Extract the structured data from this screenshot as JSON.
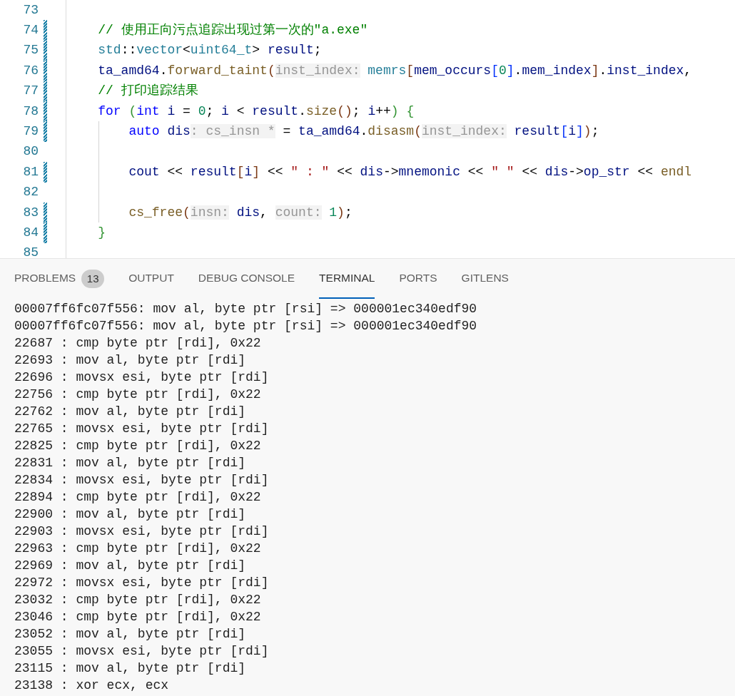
{
  "editor": {
    "lines": [
      {
        "number": "73",
        "modified": false,
        "indent_guide": false
      },
      {
        "number": "74",
        "modified": true,
        "indent_guide": false,
        "tokens": [
          {
            "kind": "comment",
            "text": "    // 使用正向污点追踪出现过第一次的\"a.exe\""
          }
        ]
      },
      {
        "number": "75",
        "modified": true,
        "indent_guide": false,
        "tokens": [
          {
            "kind": "type",
            "text": "    std"
          },
          {
            "kind": "plain",
            "text": "::"
          },
          {
            "kind": "type",
            "text": "vector"
          },
          {
            "kind": "plain",
            "text": "<"
          },
          {
            "kind": "type",
            "text": "uint64_t"
          },
          {
            "kind": "plain",
            "text": "> "
          },
          {
            "kind": "variable",
            "text": "result"
          },
          {
            "kind": "plain",
            "text": ";"
          }
        ]
      },
      {
        "number": "76",
        "modified": true,
        "indent_guide": false,
        "tokens": [
          {
            "kind": "variable",
            "text": "    ta_amd64"
          },
          {
            "kind": "plain",
            "text": "."
          },
          {
            "kind": "function",
            "text": "forward_taint"
          },
          {
            "kind": "bracket3",
            "text": "("
          },
          {
            "kind": "hint",
            "text": "inst_index:"
          },
          {
            "kind": "type",
            "text": " memrs"
          },
          {
            "kind": "bracket3",
            "text": "["
          },
          {
            "kind": "variable",
            "text": "mem_occurs"
          },
          {
            "kind": "bracket1",
            "text": "["
          },
          {
            "kind": "number",
            "text": "0"
          },
          {
            "kind": "bracket1",
            "text": "]"
          },
          {
            "kind": "plain",
            "text": "."
          },
          {
            "kind": "variable",
            "text": "mem_index"
          },
          {
            "kind": "bracket3",
            "text": "]"
          },
          {
            "kind": "plain",
            "text": "."
          },
          {
            "kind": "variable",
            "text": "inst_index"
          },
          {
            "kind": "plain",
            "text": ","
          }
        ]
      },
      {
        "number": "77",
        "modified": true,
        "indent_guide": false,
        "tokens": [
          {
            "kind": "comment",
            "text": "    // 打印追踪结果"
          }
        ]
      },
      {
        "number": "78",
        "modified": true,
        "indent_guide": false,
        "tokens": [
          {
            "kind": "keyword",
            "text": "    for "
          },
          {
            "kind": "bracket2",
            "text": "("
          },
          {
            "kind": "keyword",
            "text": "int "
          },
          {
            "kind": "variable",
            "text": "i"
          },
          {
            "kind": "plain",
            "text": " = "
          },
          {
            "kind": "number",
            "text": "0"
          },
          {
            "kind": "plain",
            "text": "; "
          },
          {
            "kind": "variable",
            "text": "i"
          },
          {
            "kind": "plain",
            "text": " < "
          },
          {
            "kind": "variable",
            "text": "result"
          },
          {
            "kind": "plain",
            "text": "."
          },
          {
            "kind": "function",
            "text": "size"
          },
          {
            "kind": "bracket3",
            "text": "()"
          },
          {
            "kind": "plain",
            "text": "; "
          },
          {
            "kind": "variable",
            "text": "i"
          },
          {
            "kind": "plain",
            "text": "++"
          },
          {
            "kind": "bracket2",
            "text": ") {"
          }
        ]
      },
      {
        "number": "79",
        "modified": true,
        "indent_guide": true,
        "tokens": [
          {
            "kind": "keyword",
            "text": "        auto "
          },
          {
            "kind": "variable",
            "text": "dis"
          },
          {
            "kind": "hint",
            "text": ": cs_insn *"
          },
          {
            "kind": "plain",
            "text": " = "
          },
          {
            "kind": "variable",
            "text": "ta_amd64"
          },
          {
            "kind": "plain",
            "text": "."
          },
          {
            "kind": "function",
            "text": "disasm"
          },
          {
            "kind": "bracket3",
            "text": "("
          },
          {
            "kind": "hint",
            "text": "inst_index:"
          },
          {
            "kind": "variable",
            "text": " result"
          },
          {
            "kind": "bracket1",
            "text": "["
          },
          {
            "kind": "variable",
            "text": "i"
          },
          {
            "kind": "bracket1",
            "text": "]"
          },
          {
            "kind": "bracket3",
            "text": ")"
          },
          {
            "kind": "plain",
            "text": ";"
          }
        ]
      },
      {
        "number": "80",
        "modified": false,
        "indent_guide": true
      },
      {
        "number": "81",
        "modified": true,
        "indent_guide": true,
        "tokens": [
          {
            "kind": "variable",
            "text": "        cout"
          },
          {
            "kind": "plain",
            "text": " << "
          },
          {
            "kind": "variable",
            "text": "result"
          },
          {
            "kind": "bracket3",
            "text": "["
          },
          {
            "kind": "variable",
            "text": "i"
          },
          {
            "kind": "bracket3",
            "text": "]"
          },
          {
            "kind": "plain",
            "text": " << "
          },
          {
            "kind": "string",
            "text": "\" : \""
          },
          {
            "kind": "plain",
            "text": " << "
          },
          {
            "kind": "variable",
            "text": "dis"
          },
          {
            "kind": "plain",
            "text": "->"
          },
          {
            "kind": "variable",
            "text": "mnemonic"
          },
          {
            "kind": "plain",
            "text": " << "
          },
          {
            "kind": "string",
            "text": "\" \""
          },
          {
            "kind": "plain",
            "text": " << "
          },
          {
            "kind": "variable",
            "text": "dis"
          },
          {
            "kind": "plain",
            "text": "->"
          },
          {
            "kind": "variable",
            "text": "op_str"
          },
          {
            "kind": "plain",
            "text": " << "
          },
          {
            "kind": "function",
            "text": "endl"
          }
        ]
      },
      {
        "number": "82",
        "modified": false,
        "indent_guide": true
      },
      {
        "number": "83",
        "modified": true,
        "indent_guide": true,
        "tokens": [
          {
            "kind": "function",
            "text": "        cs_free"
          },
          {
            "kind": "bracket3",
            "text": "("
          },
          {
            "kind": "hint",
            "text": "insn:"
          },
          {
            "kind": "variable",
            "text": " dis"
          },
          {
            "kind": "plain",
            "text": ", "
          },
          {
            "kind": "hint",
            "text": "count:"
          },
          {
            "kind": "number",
            "text": " 1"
          },
          {
            "kind": "bracket3",
            "text": ")"
          },
          {
            "kind": "plain",
            "text": ";"
          }
        ]
      },
      {
        "number": "84",
        "modified": true,
        "indent_guide": false,
        "tokens": [
          {
            "kind": "bracket2",
            "text": "    }"
          }
        ]
      },
      {
        "number": "85",
        "modified": false,
        "indent_guide": false
      }
    ]
  },
  "panel": {
    "tabs": [
      {
        "label": "PROBLEMS",
        "badge": "13",
        "selected": false
      },
      {
        "label": "OUTPUT",
        "selected": false
      },
      {
        "label": "DEBUG CONSOLE",
        "selected": false
      },
      {
        "label": "TERMINAL",
        "selected": true
      },
      {
        "label": "PORTS",
        "selected": false
      },
      {
        "label": "GITLENS",
        "selected": false
      }
    ],
    "terminal_lines": [
      "00007ff6fc07f556: mov al, byte ptr [rsi] => 000001ec340edf90",
      "00007ff6fc07f556: mov al, byte ptr [rsi] => 000001ec340edf90",
      "22687 : cmp byte ptr [rdi], 0x22",
      "22693 : mov al, byte ptr [rdi]",
      "22696 : movsx esi, byte ptr [rdi]",
      "22756 : cmp byte ptr [rdi], 0x22",
      "22762 : mov al, byte ptr [rdi]",
      "22765 : movsx esi, byte ptr [rdi]",
      "22825 : cmp byte ptr [rdi], 0x22",
      "22831 : mov al, byte ptr [rdi]",
      "22834 : movsx esi, byte ptr [rdi]",
      "22894 : cmp byte ptr [rdi], 0x22",
      "22900 : mov al, byte ptr [rdi]",
      "22903 : movsx esi, byte ptr [rdi]",
      "22963 : cmp byte ptr [rdi], 0x22",
      "22969 : mov al, byte ptr [rdi]",
      "22972 : movsx esi, byte ptr [rdi]",
      "23032 : cmp byte ptr [rdi], 0x22",
      "23046 : cmp byte ptr [rdi], 0x22",
      "23052 : mov al, byte ptr [rdi]",
      "23055 : movsx esi, byte ptr [rdi]",
      "23115 : mov al, byte ptr [rdi]",
      "23138 : xor ecx, ecx"
    ]
  }
}
